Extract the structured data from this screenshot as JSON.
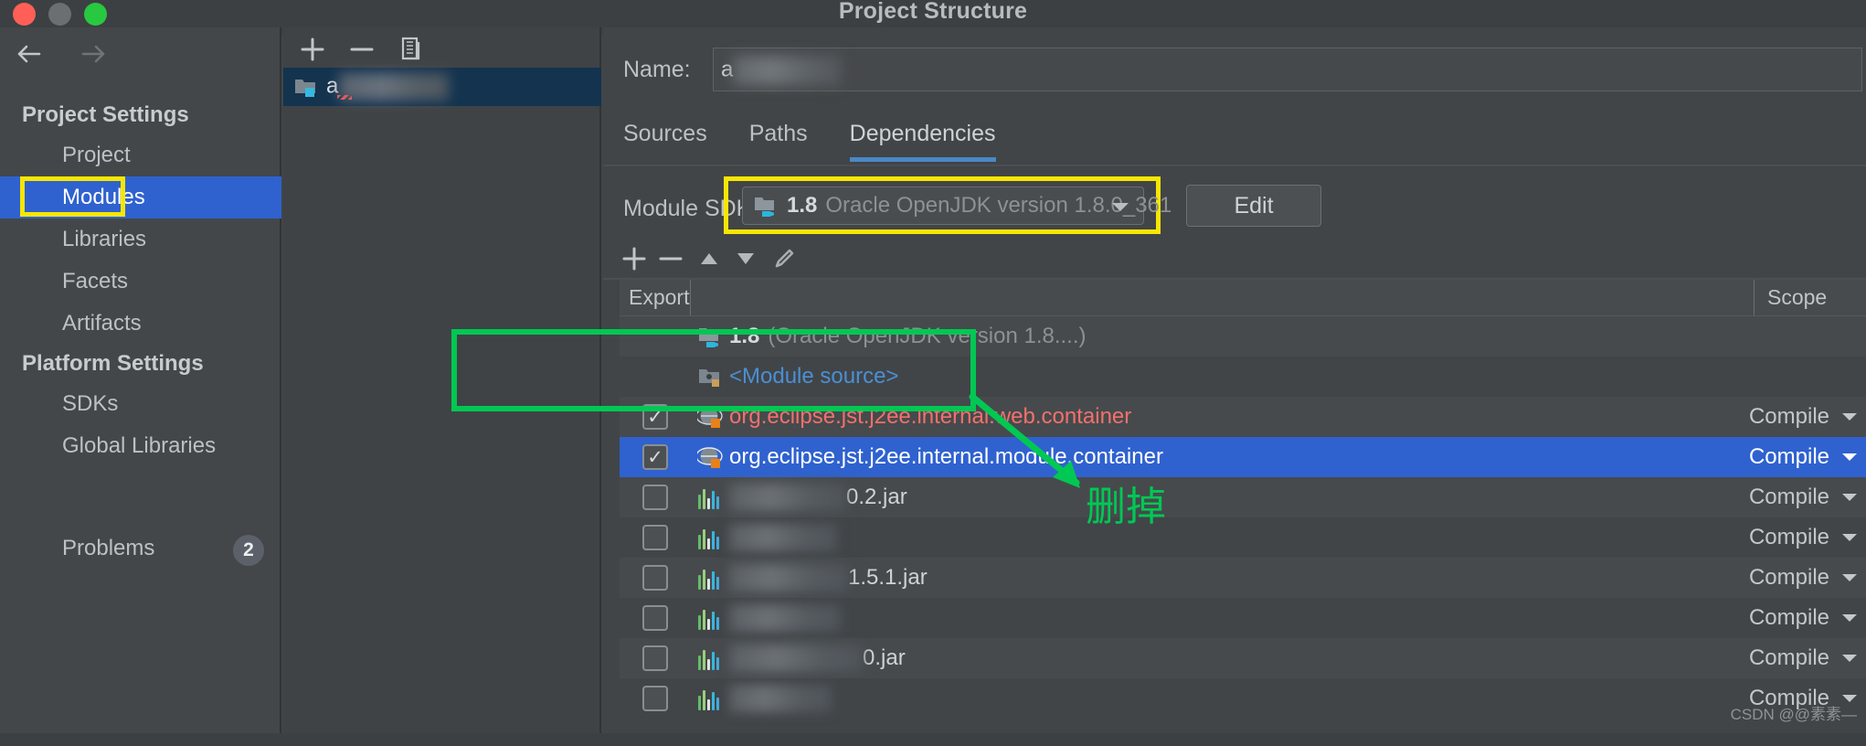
{
  "window": {
    "title": "Project Structure",
    "traffic_lights": [
      "close-dot",
      "minimize-dot",
      "maximize-dot"
    ]
  },
  "sidebar": {
    "back_icon": "arrow-left-icon",
    "forward_icon": "arrow-right-icon",
    "groups": [
      {
        "label": "Project Settings",
        "items": [
          {
            "label": "Project",
            "selected": false
          },
          {
            "label": "Modules",
            "selected": true,
            "highlight": "yellow-box"
          },
          {
            "label": "Libraries",
            "selected": false
          },
          {
            "label": "Facets",
            "selected": false
          },
          {
            "label": "Artifacts",
            "selected": false
          }
        ]
      },
      {
        "label": "Platform Settings",
        "items": [
          {
            "label": "SDKs",
            "selected": false
          },
          {
            "label": "Global Libraries",
            "selected": false
          }
        ]
      }
    ],
    "problems": {
      "label": "Problems",
      "count": "2"
    }
  },
  "module_panel": {
    "toolbar": [
      {
        "icon": "plus-icon",
        "label": "+"
      },
      {
        "icon": "minus-icon",
        "label": "−"
      },
      {
        "icon": "copy-icon",
        "label": "copy"
      }
    ],
    "selected_module": {
      "label": "a",
      "redacted": true,
      "icon": "module-folder-icon"
    }
  },
  "content": {
    "name_field": {
      "label": "Name:",
      "value": "a",
      "redacted": true
    },
    "tabs": [
      {
        "label": "Sources",
        "active": false
      },
      {
        "label": "Paths",
        "active": false
      },
      {
        "label": "Dependencies",
        "active": true
      }
    ],
    "module_sdk": {
      "label": "Module SDK",
      "version": "1.8",
      "description": "Oracle OpenJDK version 1.8.0_361",
      "icon": "jdk-folder-icon",
      "caret": "chevron-down-icon",
      "highlight": "yellow-box",
      "edit_button": "Edit"
    },
    "deps_toolbar": [
      {
        "icon": "plus-icon"
      },
      {
        "icon": "minus-icon"
      },
      {
        "icon": "arrow-up-icon"
      },
      {
        "icon": "arrow-down-icon"
      },
      {
        "icon": "pencil-edit-icon"
      }
    ],
    "table": {
      "columns": [
        "Export",
        "",
        "Scope"
      ],
      "rows": [
        {
          "checkbox": "none",
          "icon": "jdk-folder-icon",
          "name_prefix": "1.8",
          "name": "(Oracle OpenJDK version 1.8....)",
          "style": "muted",
          "scope": "",
          "selected": false,
          "alt": true
        },
        {
          "checkbox": "none",
          "icon": "module-source-folder-icon",
          "name_prefix": "",
          "name": "<Module source>",
          "style": "link",
          "scope": "",
          "selected": false,
          "alt": false
        },
        {
          "checkbox": "checked",
          "icon": "library-globe-icon",
          "name_prefix": "",
          "name": "org.eclipse.jst.j2ee.internal.web.container",
          "style": "error",
          "scope": "Compile",
          "selected": false,
          "alt": true
        },
        {
          "checkbox": "checked",
          "icon": "library-globe-icon",
          "name_prefix": "",
          "name": "org.eclipse.jst.j2ee.internal.module.container",
          "style": "selected",
          "scope": "Compile",
          "selected": true,
          "alt": false
        },
        {
          "checkbox": "unchecked",
          "icon": "jar-icon",
          "name_prefix": "",
          "name": "0.2.jar",
          "redacted_width": 128,
          "style": "normal",
          "scope": "Compile",
          "selected": false,
          "alt": true
        },
        {
          "checkbox": "unchecked",
          "icon": "jar-icon",
          "name_prefix": "",
          "name": "",
          "redacted_width": 118,
          "style": "normal",
          "scope": "Compile",
          "selected": false,
          "alt": false
        },
        {
          "checkbox": "unchecked",
          "icon": "jar-icon",
          "name_prefix": "",
          "name": "1.5.1.jar",
          "redacted_width": 130,
          "style": "normal",
          "scope": "Compile",
          "selected": false,
          "alt": true
        },
        {
          "checkbox": "unchecked",
          "icon": "jar-icon",
          "name_prefix": "",
          "name": "",
          "redacted_width": 122,
          "style": "normal",
          "scope": "Compile",
          "selected": false,
          "alt": false
        },
        {
          "checkbox": "unchecked",
          "icon": "jar-icon",
          "name_prefix": "",
          "name": "0.jar",
          "redacted_width": 146,
          "style": "normal",
          "scope": "Compile",
          "selected": false,
          "alt": true
        },
        {
          "checkbox": "unchecked",
          "icon": "jar-icon",
          "name_prefix": "",
          "name": "",
          "redacted_width": 112,
          "style": "normal",
          "scope": "Compile",
          "selected": false,
          "alt": false
        }
      ]
    }
  },
  "annotations": {
    "green_box_target": "two container rows",
    "green_arrow": "arrow-pointing-down-right",
    "note_text": "删掉",
    "colors": {
      "highlight_yellow": "#f7e600",
      "annotation_green": "#00c853",
      "selection_blue": "#2f62cf",
      "tab_underline": "#4a88c7",
      "error_red": "#f4706b",
      "link_blue": "#4b8fd4"
    }
  },
  "watermark": "CSDN @@素素—"
}
